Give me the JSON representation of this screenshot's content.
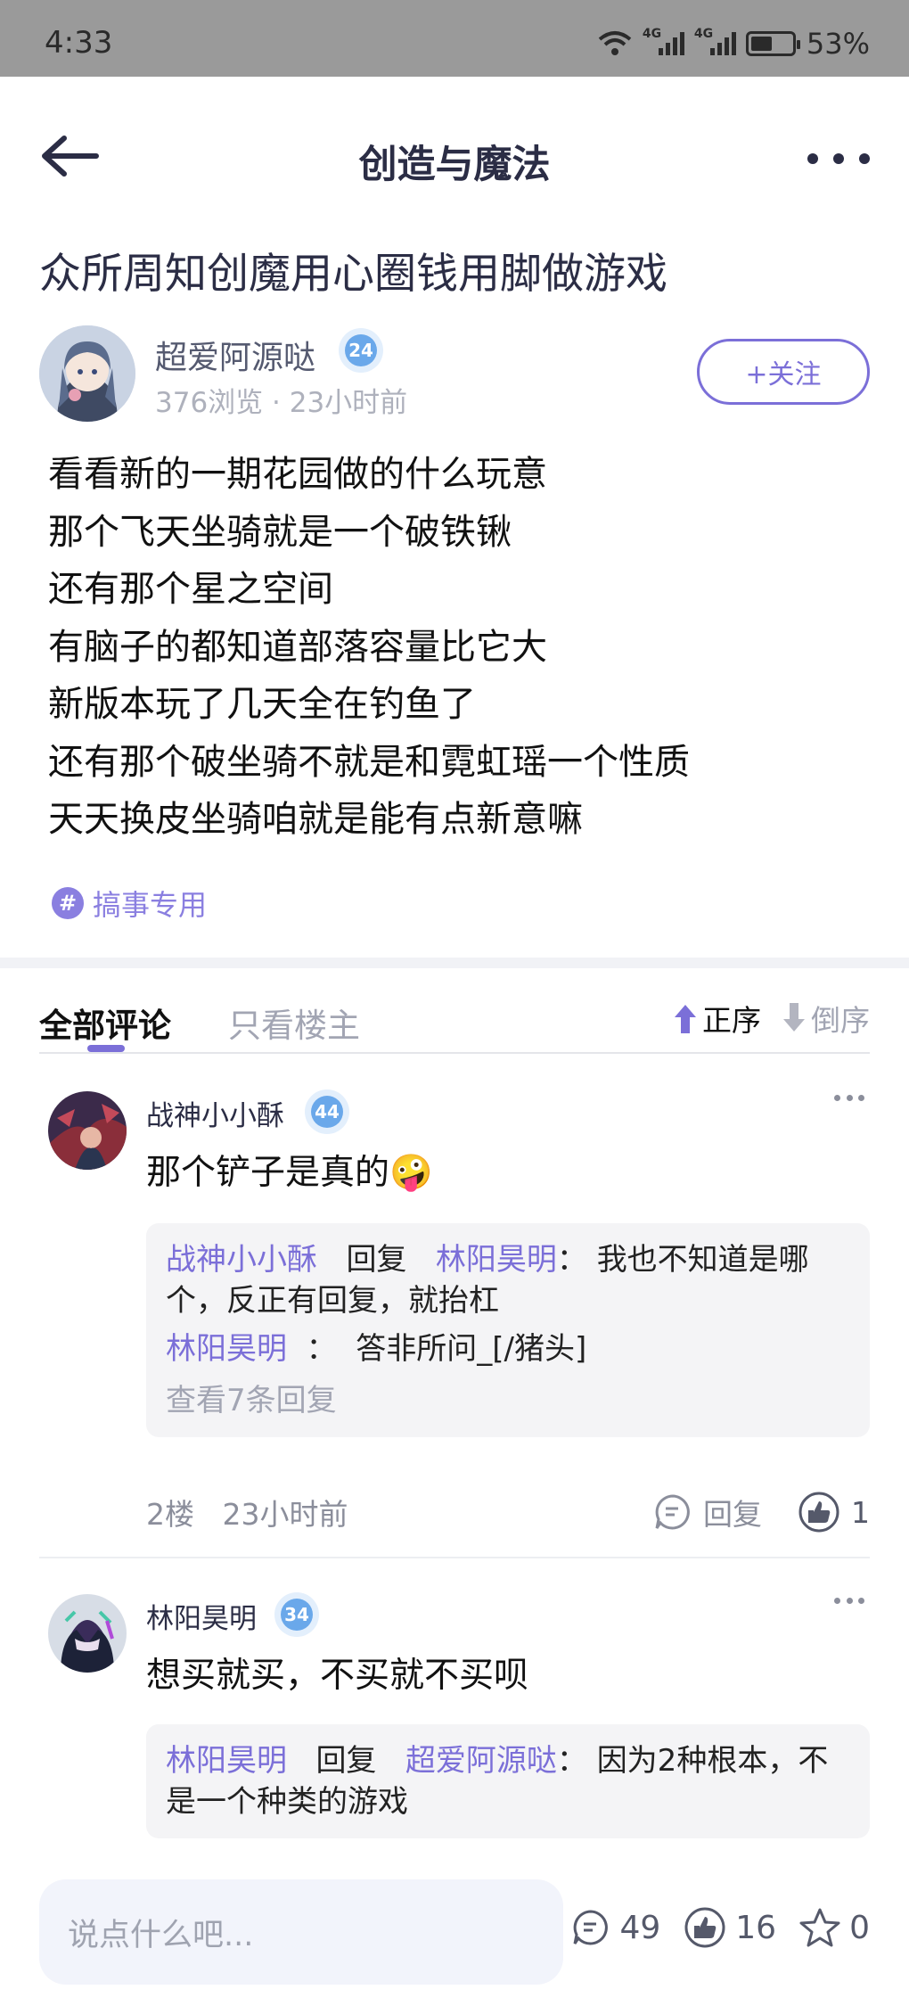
{
  "status_bar": {
    "time": "4:33",
    "network": "4G",
    "battery": "53%",
    "battery_level": 0.53
  },
  "nav": {
    "title": "创造与魔法"
  },
  "post": {
    "title": "众所周知创魔用心圈钱用脚做游戏",
    "author": {
      "name": "超爱阿源哒",
      "level": "24",
      "meta": "376浏览 · 23小时前"
    },
    "follow_label": "+关注",
    "body": [
      "看看新的一期花园做的什么玩意",
      "那个飞天坐骑就是一个破铁锹",
      "还有那个星之空间",
      "有脑子的都知道部落容量比它大",
      "新版本玩了几天全在钓鱼了",
      "还有那个破坐骑不就是和霓虹瑶一个性质",
      "天天换皮坐骑咱就是能有点新意嘛"
    ],
    "tag": "搞事专用"
  },
  "comments_tabs": {
    "all": "全部评论",
    "op_only": "只看楼主",
    "asc": "正序",
    "desc": "倒序"
  },
  "comments": [
    {
      "name": "战神小小酥",
      "level": "44",
      "text": "那个铲子是真的🤪",
      "replies": [
        {
          "user": "战神小小酥",
          "verb": "回复",
          "target": "林阳昊明",
          "sep": "：",
          "text": "我也不知道是哪个，反正有回复，就抬杠"
        },
        {
          "user": "林阳昊明",
          "sep": "：",
          "text": "答非所问_[/猪头]"
        }
      ],
      "view_more": "查看7条回复",
      "floor": "2楼",
      "time": "23小时前",
      "reply_label": "回复",
      "likes": "1"
    },
    {
      "name": "林阳昊明",
      "level": "34",
      "text": "想买就买，不买就不买呗",
      "replies": [
        {
          "user": "林阳昊明",
          "verb": "回复",
          "target": "超爱阿源哒",
          "sep": "：",
          "text": "因为2种根本，不是一个种类的游戏"
        }
      ]
    }
  ],
  "bottom_bar": {
    "placeholder": "说点什么吧...",
    "comments": "49",
    "likes": "16",
    "favorites": "0"
  },
  "colors": {
    "accent": "#7b6fd8",
    "title": "#2b2d45",
    "muted": "#a2a5b3",
    "badge": "#6aa8ea"
  }
}
